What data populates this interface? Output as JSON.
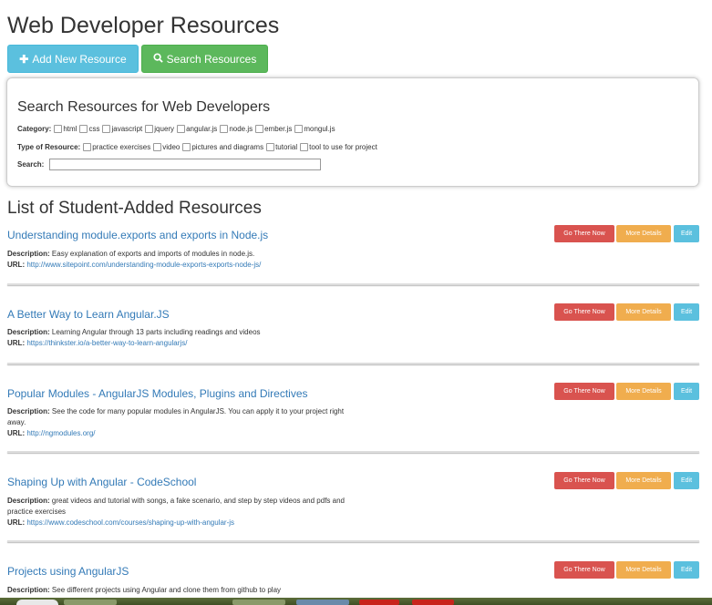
{
  "page": {
    "title": "Web Developer Resources"
  },
  "toolbar": {
    "add_label": "Add New Resource",
    "add_icon": "plus-icon",
    "search_label": "Search Resources",
    "search_icon": "search-icon"
  },
  "search_panel": {
    "title": "Search Resources for Web Developers",
    "category_label": "Category:",
    "categories": [
      "html",
      "css",
      "javascript",
      "jquery",
      "angular.js",
      "node.js",
      "ember.js",
      "mongul.js"
    ],
    "type_label": "Type of Resource:",
    "types": [
      "practice exercises",
      "video",
      "pictures and diagrams",
      "tutorial",
      "tool to use for project"
    ],
    "search_label": "Search:",
    "search_value": ""
  },
  "list": {
    "title": "List of Student-Added Resources",
    "go_label": "Go There Now",
    "details_label": "More Details",
    "edit_label": "Edit",
    "desc_label": "Description:",
    "url_label": "URL:",
    "items": [
      {
        "title": "Understanding module.exports and exports in Node.js",
        "description": "Easy explanation of exports and imports of modules in node.js.",
        "url": "http://www.sitepoint.com/understanding-module-exports-exports-node-js/"
      },
      {
        "title": "A Better Way to Learn Angular.JS",
        "description": "Learning Angular through 13 parts including readings and videos",
        "url": "https://thinkster.io/a-better-way-to-learn-angularjs/"
      },
      {
        "title": "Popular Modules - AngularJS Modules, Plugins and Directives",
        "description": "See the code for many popular modules in AngularJS. You can apply it to your project right away.",
        "url": "http://ngmodules.org/"
      },
      {
        "title": "Shaping Up with Angular - CodeSchool",
        "description": "great videos and tutorial with songs, a fake scenario, and step by step videos and pdfs and practice exercises",
        "url": "https://www.codeschool.com/courses/shaping-up-with-angular-js"
      },
      {
        "title": "Projects using AngularJS",
        "description": "See different projects using Angular and clone them from github to play",
        "url": ""
      }
    ]
  },
  "colors": {
    "info": "#5bc0de",
    "success": "#5cb85c",
    "danger": "#d9534f",
    "warning": "#f0ad4e",
    "link": "#337ab7"
  }
}
